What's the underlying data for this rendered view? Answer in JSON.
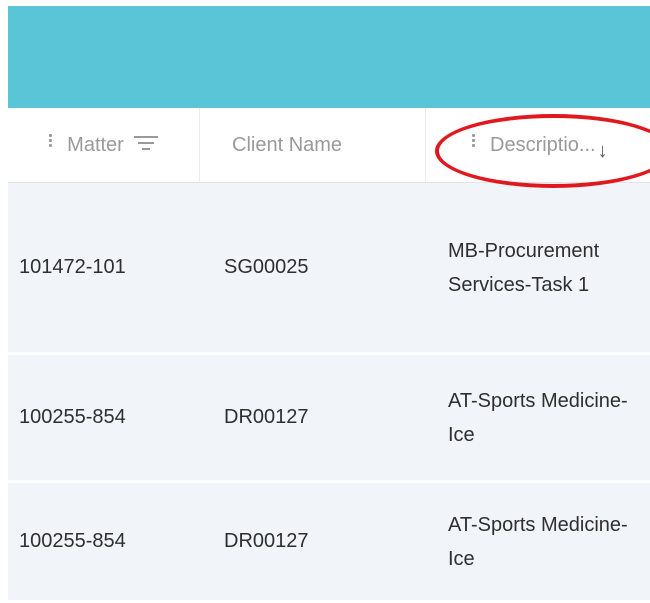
{
  "colors": {
    "banner": "#5bc5d8",
    "header_text": "#9a9a9a",
    "row_bg": "#f1f4f8",
    "highlight": "#e0191f"
  },
  "table": {
    "columns": [
      {
        "label": "Matter",
        "icon": "filter-icon"
      },
      {
        "label": "Client Name"
      },
      {
        "label": "Descriptio...",
        "sort_indicator": "↓"
      }
    ],
    "rows": [
      {
        "matter": "101472-101",
        "client": "SG00025",
        "description": "MB-Procurement Services-Task 1"
      },
      {
        "matter": "100255-854",
        "client": "DR00127",
        "description": "AT-Sports Medicine-Ice"
      },
      {
        "matter": "100255-854",
        "client": "DR00127",
        "description": "AT-Sports Medicine-Ice"
      }
    ]
  }
}
